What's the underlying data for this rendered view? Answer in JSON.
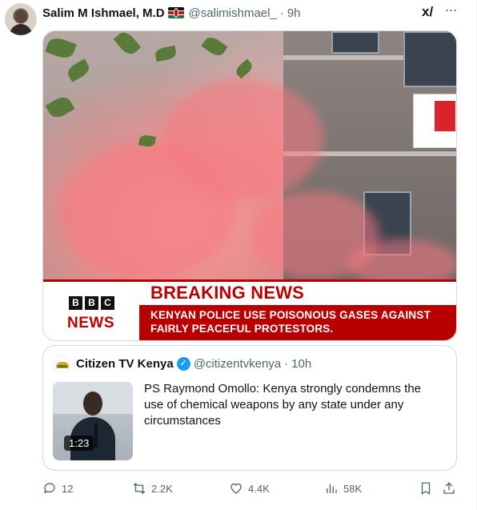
{
  "author": {
    "name": "Salim M Ishmael, M.D",
    "flag_icon": "kenya-flag-icon",
    "handle": "@salimishmael_",
    "separator": "·",
    "time": "9h"
  },
  "top_icons": {
    "grok": "grok-icon",
    "grok_glyph": "x/",
    "more": "more-icon",
    "more_glyph": "···"
  },
  "media": {
    "bbc_letters": [
      "B",
      "B",
      "C"
    ],
    "bbc_news": "NEWS",
    "breaking": "BREAKING NEWS",
    "headline": "KENYAN POLICE USE POISONOUS GASES AGAINST FAIRLY PEACEFUL PROTESTORS."
  },
  "quoted": {
    "name": "Citizen TV Kenya",
    "verified_icon": "verified-badge-icon",
    "verified_glyph": "✓",
    "handle": "@citizentvkenya",
    "separator": "·",
    "time": "10h",
    "video_duration": "1:23",
    "text": "PS Raymond Omollo: Kenya strongly condemns the use of chemical weapons by any state under any circumstances"
  },
  "actions": {
    "replies": "12",
    "reposts": "2.2K",
    "likes": "4.4K",
    "views": "58K"
  },
  "colors": {
    "bbc_red": "#b80000",
    "verified_blue": "#1d9bf0",
    "muted_text": "#536471"
  }
}
